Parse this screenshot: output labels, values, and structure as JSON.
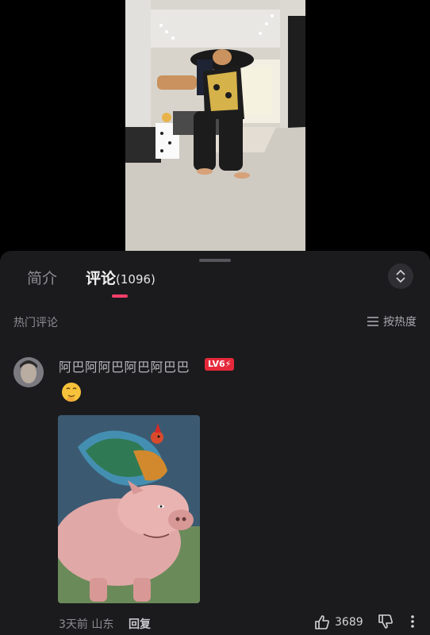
{
  "tabs": [
    {
      "label": "简介"
    },
    {
      "label": "评论",
      "count": "(1096)"
    }
  ],
  "section": {
    "label": "热门评论",
    "sort_label": "按热度"
  },
  "comment": {
    "username": "阿巴阿阿巴阿巴阿巴巴",
    "level": "LV6⚡",
    "time": "3天前",
    "location": "山东",
    "reply_label": "回复",
    "like_count": "3689"
  },
  "icons": {
    "collapse": "chevron-up-down-icon",
    "sort": "list-icon",
    "like": "thumbs-up-icon",
    "dislike": "thumbs-down-icon",
    "more": "vertical-dots-icon"
  },
  "colors": {
    "accent": "#ff3e6c",
    "level_badge": "#e5283a",
    "sheet_bg": "#1b1b1d"
  }
}
